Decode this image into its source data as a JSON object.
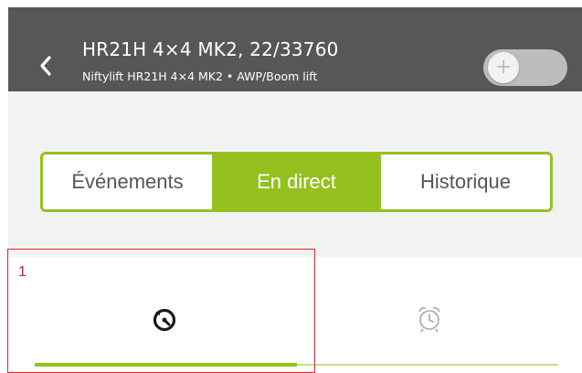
{
  "header": {
    "title": "HR21H 4×4 MK2, 22/33760",
    "subtitle": "Niftylift HR21H 4×4 MK2 • AWP/Boom lift",
    "toggle_symbol": "+"
  },
  "segments": [
    {
      "label": "Événements",
      "active": false
    },
    {
      "label": "En direct",
      "active": true
    },
    {
      "label": "Historique",
      "active": false
    }
  ],
  "tabs": [
    {
      "icon": "live-gauge-icon",
      "active": true
    },
    {
      "icon": "alarm-clock-icon",
      "active": false
    }
  ],
  "annotation": {
    "label": "1"
  },
  "colors": {
    "accent": "#95c11f",
    "header_bg": "#575757",
    "annotation": "#e0262b"
  }
}
